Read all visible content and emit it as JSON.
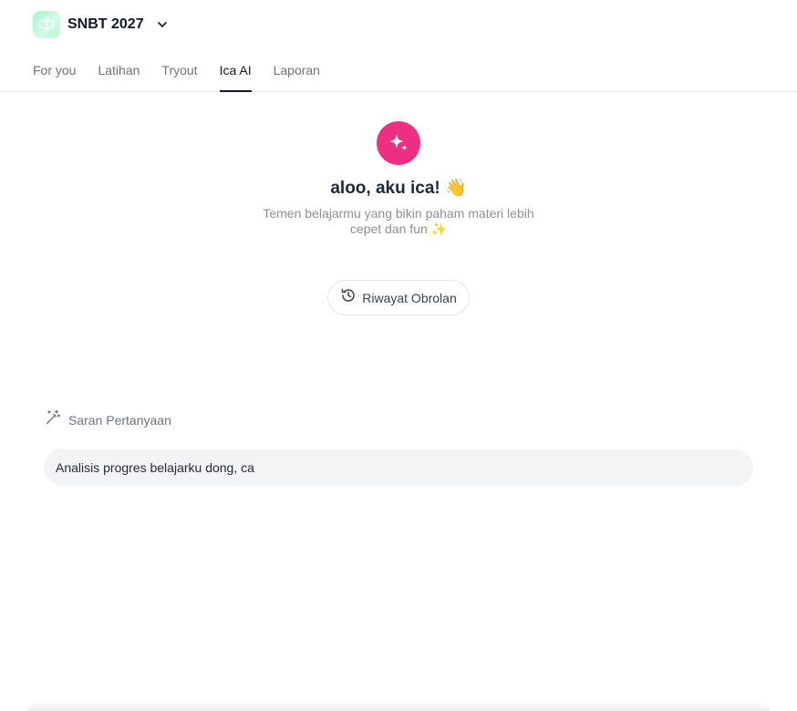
{
  "brand": {
    "name": "SNBT 2027",
    "logo_icon": "leaf-book-icon",
    "dropdown_icon": "chevron-down-icon"
  },
  "tabs": [
    {
      "label": "For you",
      "active": false
    },
    {
      "label": "Latihan",
      "active": false
    },
    {
      "label": "Tryout",
      "active": false
    },
    {
      "label": "Ica AI",
      "active": true
    },
    {
      "label": "Laporan",
      "active": false
    }
  ],
  "hero": {
    "icon": "sparkle-icon",
    "accent_color": "#ec2f80",
    "title": "aloo, aku ica! 👋",
    "subtitle": "Temen belajarmu yang bikin paham materi lebih cepet dan fun ✨"
  },
  "history_button": {
    "label": "Riwayat Obrolan",
    "icon": "history-icon"
  },
  "suggestions": {
    "heading": "Saran Pertanyaan",
    "icon": "magic-wand-icon",
    "items": [
      "Analisis progres belajarku dong, ca"
    ]
  }
}
